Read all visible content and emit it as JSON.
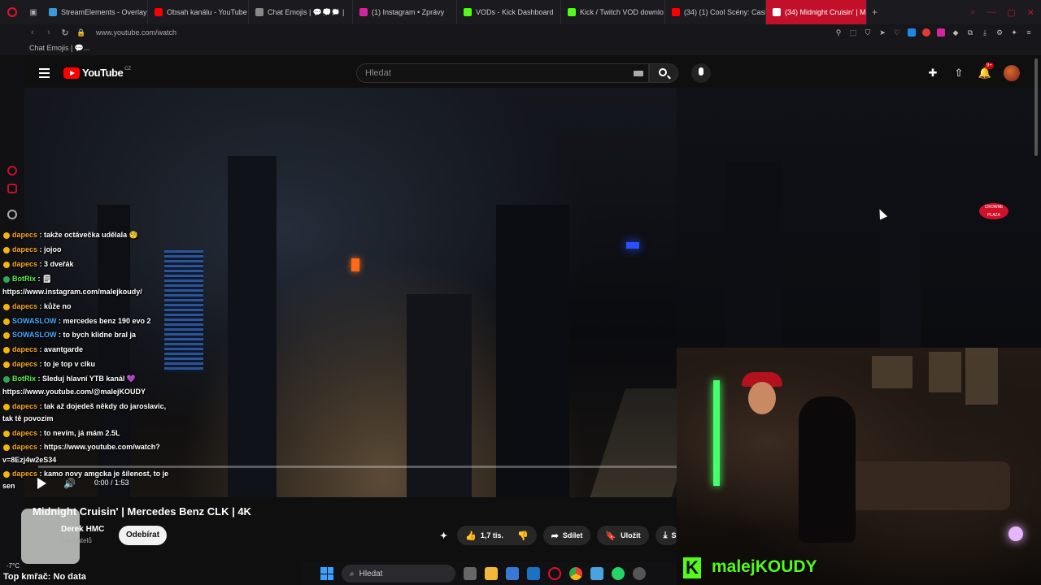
{
  "browser": {
    "tabs": [
      {
        "label": "StreamElements - Overlay",
        "color": "#3a9ad9"
      },
      {
        "label": "Obsah kanálu - YouTube S",
        "color": "#ff0000"
      },
      {
        "label": "Chat Emojis | 💬💭🗯️ |",
        "color": "#888888"
      },
      {
        "label": "(1) Instagram • Zprávy",
        "color": "#d6249f"
      },
      {
        "label": "VODs - Kick Dashboard",
        "color": "#53fc18"
      },
      {
        "label": "Kick / Twitch VOD downlo",
        "color": "#53fc18"
      },
      {
        "label": "(34) (1) Cool Scény: Casin",
        "color": "#ff0000"
      },
      {
        "label": "(34) Midnight Cruisin' | Me",
        "color": "#ff0000"
      }
    ],
    "new_tab": "+",
    "url": "www.youtube.com/watch",
    "bookmark": "Chat Emojis | 💬..."
  },
  "yt": {
    "logo_text": "YouTube",
    "region": "CZ",
    "search_placeholder": "Hledat",
    "notif_badge": "9+"
  },
  "player": {
    "time": "0:00 / 1:53",
    "progress_fraction": 0.0,
    "sign_text": "CROWNE PLAZA"
  },
  "chat": [
    {
      "user": "dapecs",
      "type": "dapecs",
      "msg": " : takže octávečka udělala 🧐"
    },
    {
      "user": "dapecs",
      "type": "dapecs",
      "msg": " : jojoo"
    },
    {
      "user": "dapecs",
      "type": "dapecs",
      "msg": " : 3 dveřák"
    },
    {
      "user": "BotRix",
      "type": "botrix",
      "msg": " : 🗒"
    },
    {
      "user": "",
      "type": "plain",
      "msg": "https://www.instagram.com/malejkoudy/"
    },
    {
      "user": "dapecs",
      "type": "dapecs",
      "msg": " : kůže no"
    },
    {
      "user": "SOWASLOW",
      "type": "sowa",
      "msg": " : mercedes benz 190 evo 2"
    },
    {
      "user": "SOWASLOW",
      "type": "sowa",
      "msg": " : to bych klidne bral ja"
    },
    {
      "user": "dapecs",
      "type": "dapecs",
      "msg": " : avantgarde"
    },
    {
      "user": "dapecs",
      "type": "dapecs",
      "msg": " : to je top v clku"
    },
    {
      "user": "BotRix",
      "type": "botrix",
      "msg": " : Sleduj hlavní YTB kanál 💜"
    },
    {
      "user": "",
      "type": "plain",
      "msg": "https://www.youtube.com/@malejKOUDY"
    },
    {
      "user": "dapecs",
      "type": "dapecs",
      "msg": " : tak až dojedeš někdy do jaroslavic,"
    },
    {
      "user": "",
      "type": "plain",
      "msg": "tak tě povozim"
    },
    {
      "user": "dapecs",
      "type": "dapecs",
      "msg": " : to nevím, já mám 2.5L"
    },
    {
      "user": "dapecs",
      "type": "dapecs",
      "msg": " : https://www.youtube.com/watch?"
    },
    {
      "user": "",
      "type": "plain",
      "msg": "v=8Ezj4w2eS34"
    },
    {
      "user": "dapecs",
      "type": "dapecs",
      "msg": " : kamo novy amgcka je šílenost, to je"
    },
    {
      "user": "",
      "type": "plain",
      "msg": "sen"
    }
  ],
  "video": {
    "title": "Midnight Cruisin' | Mercedes Benz CLK | 4K",
    "channel": "Derek HMC",
    "subs": "odběratelů",
    "subscribe": "Odebírat",
    "likes": "1,7 tis.",
    "share": "Sdílet",
    "save": "Uložit",
    "download": "S"
  },
  "stream": {
    "name": "malejKOUDY",
    "kick_letter": "K"
  },
  "taskbar": {
    "search": "Hledat"
  },
  "overlay": {
    "weather": "-7°C",
    "fps": "Top kmřač: No data"
  }
}
